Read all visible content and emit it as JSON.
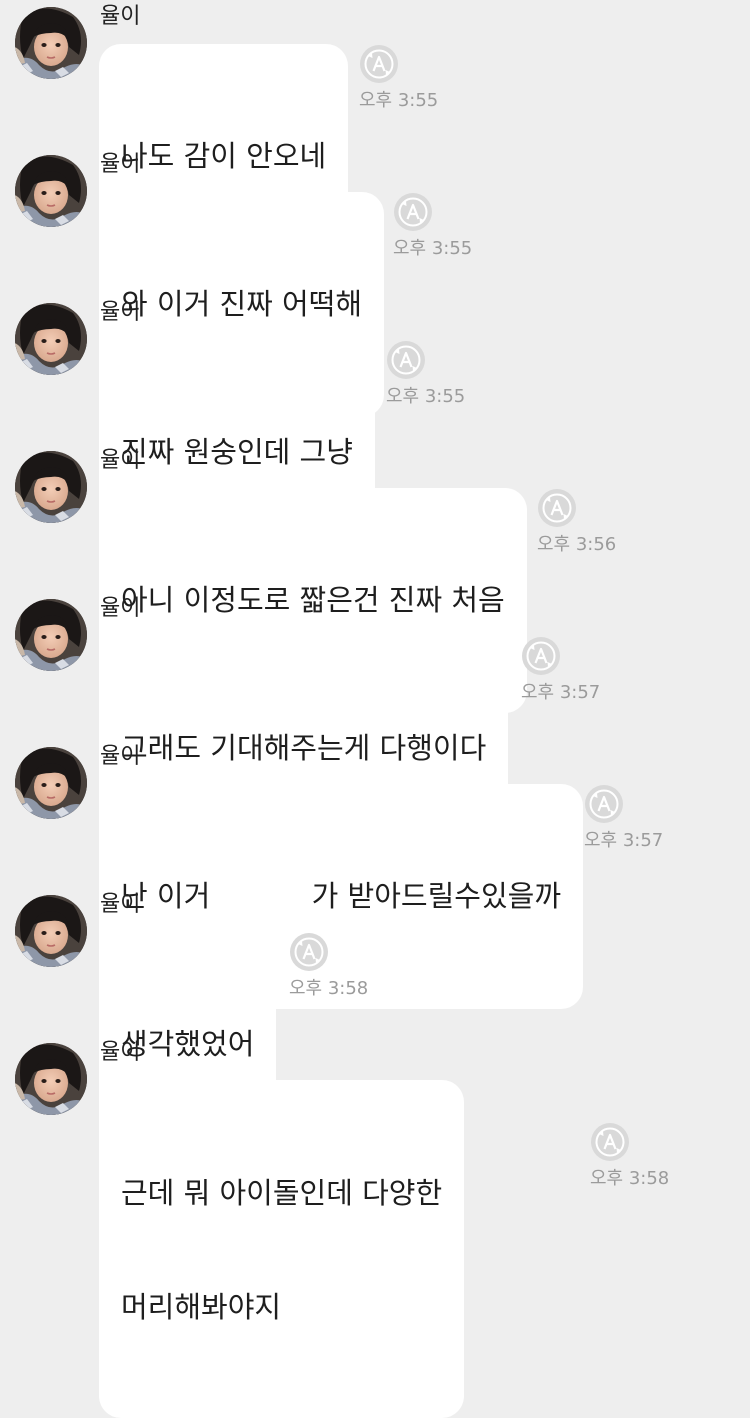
{
  "conversation": {
    "messages": [
      {
        "sender": "율이",
        "lines": [
          "나도 감이 안오네"
        ],
        "time": "오후 3:55",
        "reaction_icon": "translate-a-icon"
      },
      {
        "sender": "율이",
        "lines": [
          "와 이거 진짜 어떡해"
        ],
        "time": "오후 3:55",
        "reaction_icon": "translate-a-icon"
      },
      {
        "sender": "율이",
        "lines": [
          "진짜 원숭인데 그냥"
        ],
        "time": "오후 3:55",
        "reaction_icon": "translate-a-icon"
      },
      {
        "sender": "율이",
        "lines": [
          "아니 이정도로 짧은건 진짜 처음"
        ],
        "time": "오후 3:56",
        "reaction_icon": "translate-a-icon"
      },
      {
        "sender": "율이",
        "lines": [
          "그래도 기대해주는게 다행이다"
        ],
        "time": "오후 3:57",
        "reaction_icon": "translate-a-icon"
      },
      {
        "sender": "율이",
        "lines": [
          "난 이거           가 받아드릴수있을까"
        ],
        "time": "오후 3:57",
        "reaction_icon": "translate-a-icon"
      },
      {
        "sender": "율이",
        "lines": [
          "생각했었어"
        ],
        "time": "오후 3:58",
        "reaction_icon": "translate-a-icon"
      },
      {
        "sender": "율이",
        "lines": [
          "근데 뭐 아이돌인데 다양한",
          "머리해봐야지"
        ],
        "time": "오후 3:58",
        "reaction_icon": "translate-a-icon"
      }
    ]
  },
  "colors": {
    "background": "#eeeeee",
    "bubble": "#ffffff",
    "timestamp": "#9b9b9b",
    "reaction_icon": "#c4c4c4"
  }
}
